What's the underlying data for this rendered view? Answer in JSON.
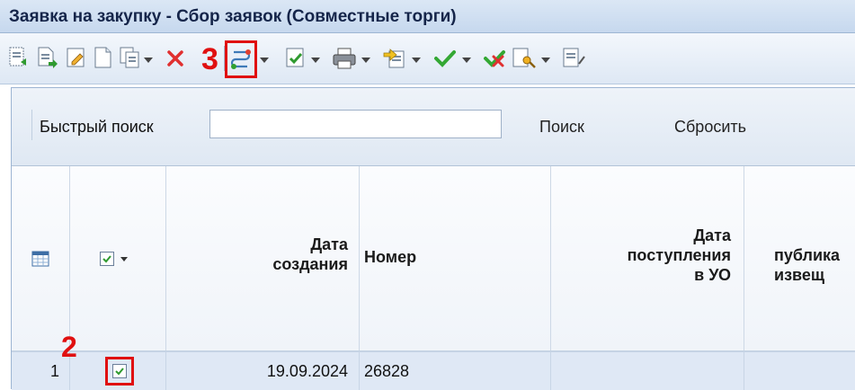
{
  "window": {
    "title": "Заявка на закупку - Сбор заявок (Совместные торги)"
  },
  "toolbar": {
    "icons": [
      "new-doc-icon",
      "create-doc-icon",
      "edit-doc-icon",
      "blank-doc-icon",
      "copy-doc-icon",
      "delete-icon",
      "route-icon",
      "check-doc-icon",
      "print-icon",
      "export-icon",
      "approve-check-icon",
      "reject-check-icon",
      "key-doc-icon",
      "doc-more-icon"
    ],
    "marker_3": "3"
  },
  "search": {
    "label": "Быстрый поиск",
    "input_value": "",
    "search_button": "Поиск",
    "reset_button": "Сбросить"
  },
  "grid": {
    "columns": [
      {
        "id": "menu",
        "label": ""
      },
      {
        "id": "select",
        "label": ""
      },
      {
        "id": "created",
        "label_lines": [
          "Дата",
          "создания"
        ]
      },
      {
        "id": "number",
        "label_lines": [
          "Номер"
        ]
      },
      {
        "id": "received",
        "label_lines": [
          "Дата",
          "поступления",
          "в УО"
        ]
      },
      {
        "id": "published",
        "label_lines": [
          "",
          "публика",
          "извещ"
        ]
      }
    ],
    "rows": [
      {
        "index": "1",
        "checked": true,
        "created": "19.09.2024",
        "number": "26828",
        "received": "",
        "published": ""
      }
    ],
    "marker_2": "2"
  },
  "colors": {
    "accent": "#e01010",
    "title_bg": "#c6d8ee",
    "selected_row": "#dfe8f5"
  }
}
